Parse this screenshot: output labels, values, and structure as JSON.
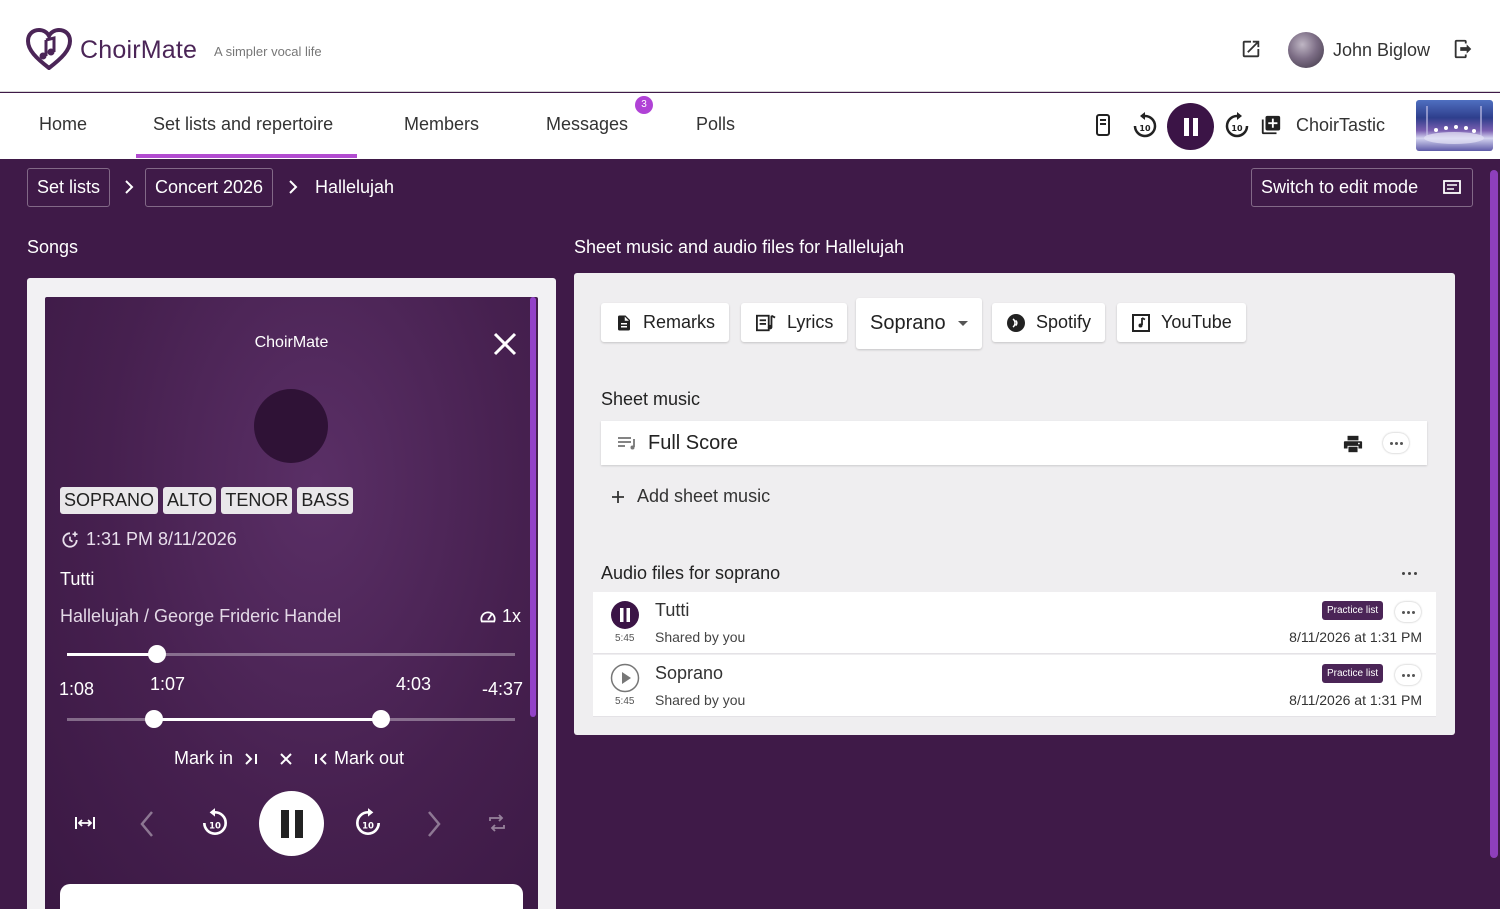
{
  "header": {
    "brand": "ChoirMate",
    "tagline": "A simpler vocal life",
    "user_name": "John Biglow"
  },
  "nav": {
    "items": [
      {
        "label": "Home"
      },
      {
        "label": "Set lists and repertoire",
        "active": true
      },
      {
        "label": "Members"
      },
      {
        "label": "Messages",
        "badge": "3"
      },
      {
        "label": "Polls"
      }
    ],
    "choir_name": "ChoirTastic"
  },
  "breadcrumb": {
    "items": [
      "Set lists",
      "Concert 2026"
    ],
    "current": "Hallelujah",
    "edit_mode_label": "Switch to edit mode"
  },
  "songs": {
    "title": "Songs",
    "player": {
      "title": "ChoirMate",
      "voices": [
        "SOPRANO",
        "ALTO",
        "TENOR",
        "BASS"
      ],
      "timestamp": "1:31 PM 8/11/2026",
      "track": "Tutti",
      "info": "Hallelujah / George Frideric Handel",
      "speed": "1x",
      "progress_fraction": 0.2,
      "elapsed": "1:08",
      "remaining": "-4:37",
      "loop_start": "1:07",
      "loop_end": "4:03",
      "loop_start_fraction": 0.195,
      "loop_end_fraction": 0.7,
      "mark_in": "Mark in",
      "mark_out": "Mark out"
    }
  },
  "files": {
    "title": "Sheet music and audio files for Hallelujah",
    "toolbar": {
      "remarks": "Remarks",
      "lyrics": "Lyrics",
      "voice_select": "Soprano",
      "spotify": "Spotify",
      "youtube": "YouTube"
    },
    "sheet_music": {
      "title": "Sheet music",
      "items": [
        {
          "name": "Full Score"
        }
      ],
      "add_label": "Add sheet music"
    },
    "audio": {
      "title": "Audio files for soprano",
      "items": [
        {
          "name": "Tutti",
          "duration": "5:45",
          "shared": "Shared by you",
          "date": "8/11/2026 at 1:31 PM",
          "tag": "Practice list",
          "state": "playing"
        },
        {
          "name": "Soprano",
          "duration": "5:45",
          "shared": "Shared by you",
          "date": "8/11/2026 at 1:31 PM",
          "tag": "Practice list",
          "state": "paused"
        }
      ]
    }
  },
  "colors": {
    "page_bg": "#3f1a48",
    "brand": "#4b2557",
    "accent": "#b24cd0",
    "badge": "#b042d6"
  },
  "icons": [
    "heart-logo-icon",
    "external-link-icon",
    "logout-icon",
    "phone-icon",
    "replay-10-icon",
    "pause-icon",
    "forward-10-icon",
    "library-icon",
    "chevron-right-icon",
    "edit-mode-icon",
    "close-icon",
    "schedule-icon",
    "speed-icon",
    "fit-width-icon",
    "previous-icon",
    "next-icon",
    "repeat-icon",
    "document-icon",
    "lyrics-icon",
    "spotify-icon",
    "youtube-icon",
    "sheet-icon",
    "print-icon",
    "plus-icon",
    "more-icon",
    "play-icon"
  ]
}
